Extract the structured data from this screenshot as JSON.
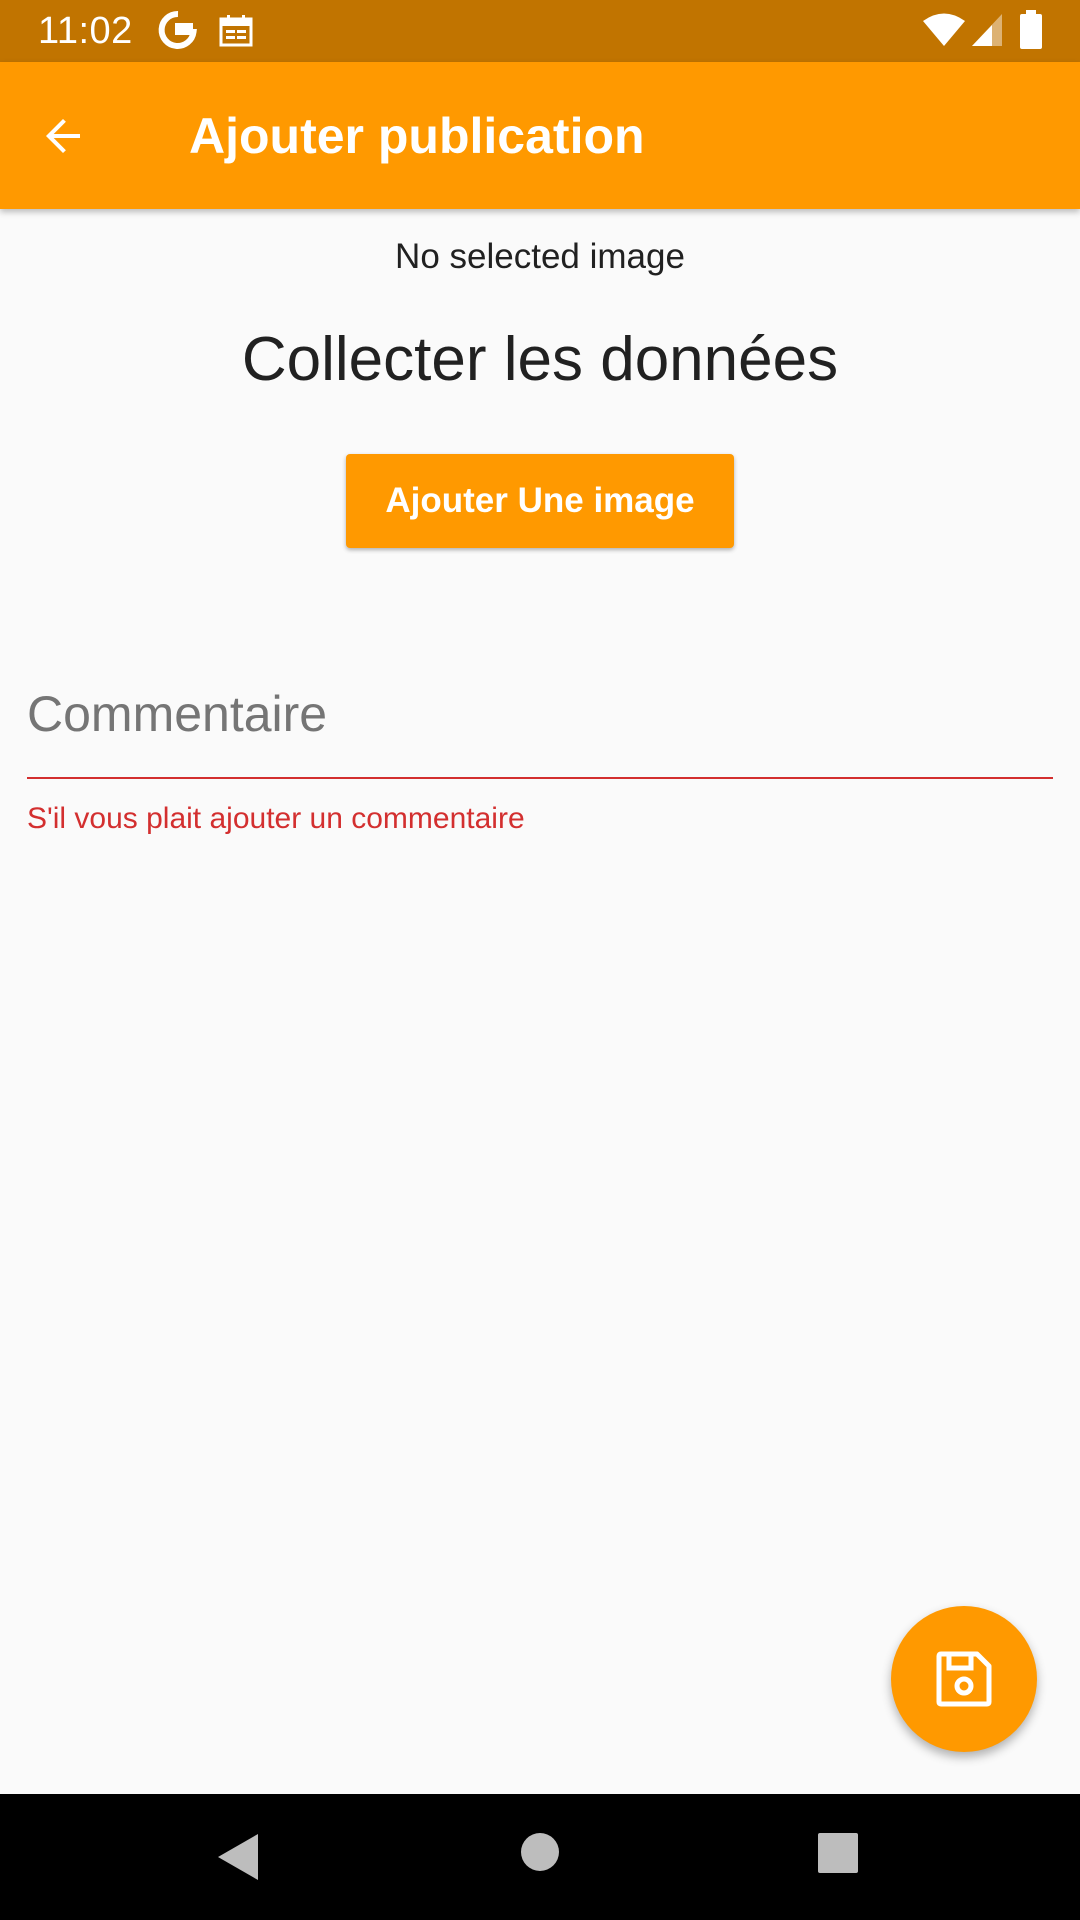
{
  "status_bar": {
    "time": "11:02",
    "background_color": "#c17400",
    "icons": [
      "google-icon",
      "calendar-icon",
      "wifi-icon",
      "signal-icon",
      "battery-icon"
    ]
  },
  "app_bar": {
    "title": "Ajouter publication",
    "back_icon": "arrow-back-icon",
    "background_color": "#ff9900"
  },
  "content": {
    "no_image_text": "No selected image",
    "section_title": "Collecter les données",
    "add_image_button_label": "Ajouter Une image",
    "comment_field": {
      "placeholder": "Commentaire",
      "value": "",
      "error": "S'il vous plait ajouter un commentaire",
      "error_color": "#d32f2f"
    }
  },
  "fab": {
    "icon": "save-icon",
    "color": "#ff9900"
  },
  "nav_bar": {
    "icons": [
      "nav-back-icon",
      "nav-home-icon",
      "nav-recents-icon"
    ]
  }
}
